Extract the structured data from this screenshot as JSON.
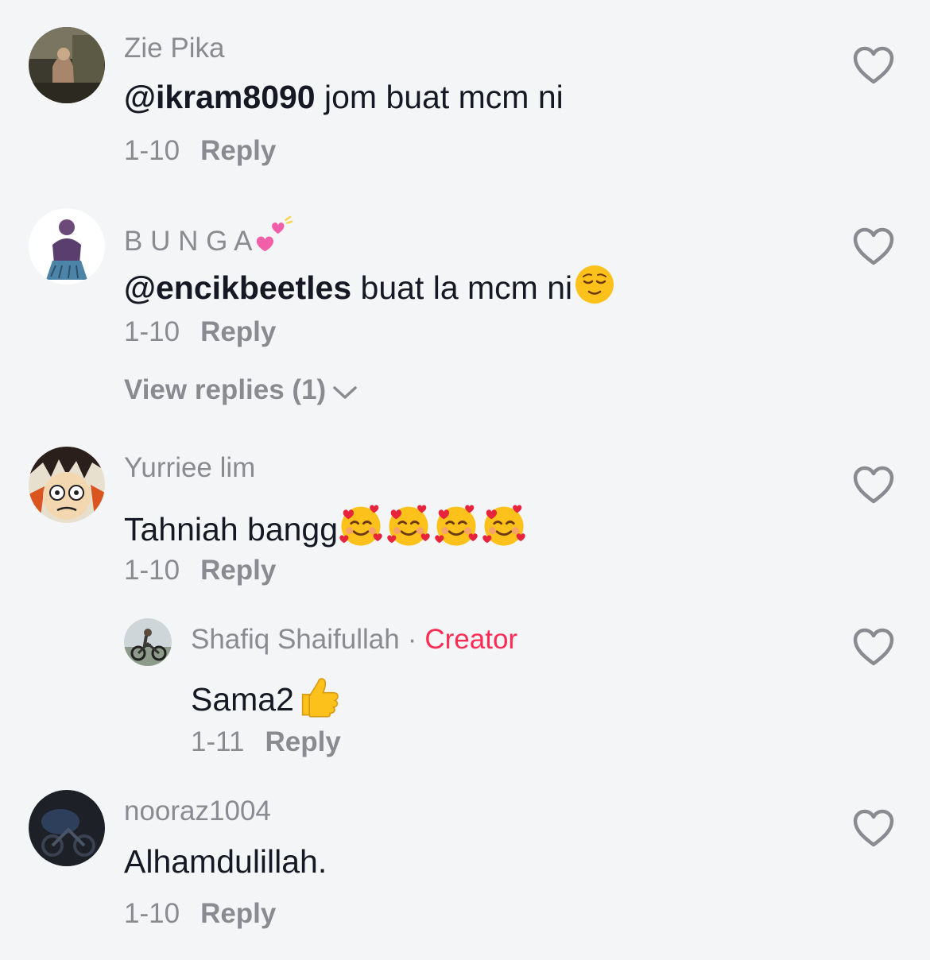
{
  "comments": [
    {
      "username": "Zie Pika",
      "mention": "@ikram8090",
      "text": " jom buat mcm ni",
      "date": "1-10",
      "reply_label": "Reply"
    },
    {
      "username": "B U N G A",
      "username_emoji": "two-hearts-emoji",
      "mention": "@encikbeetles",
      "text": " buat la mcm ni",
      "text_emoji": "relieved-face-emoji",
      "date": "1-10",
      "reply_label": "Reply",
      "view_replies": "View replies (1)"
    },
    {
      "username": "Yurriee lim",
      "text": "Tahniah bangg",
      "text_emoji": "smiling-face-with-hearts-emoji x4",
      "date": "1-10",
      "reply_label": "Reply"
    },
    {
      "username": "Shafiq Shaifullah",
      "separator": "·",
      "badge": "Creator",
      "text": "Sama2",
      "text_emoji": "thumbs-up-emoji",
      "date": "1-11",
      "reply_label": "Reply"
    },
    {
      "username": "nooraz1004",
      "text": "Alhamdulillah.",
      "date": "1-10",
      "reply_label": "Reply"
    }
  ],
  "colors": {
    "background": "#f4f5f7",
    "text": "#161823",
    "muted": "#8a8b91",
    "creator": "#fe2c55"
  }
}
